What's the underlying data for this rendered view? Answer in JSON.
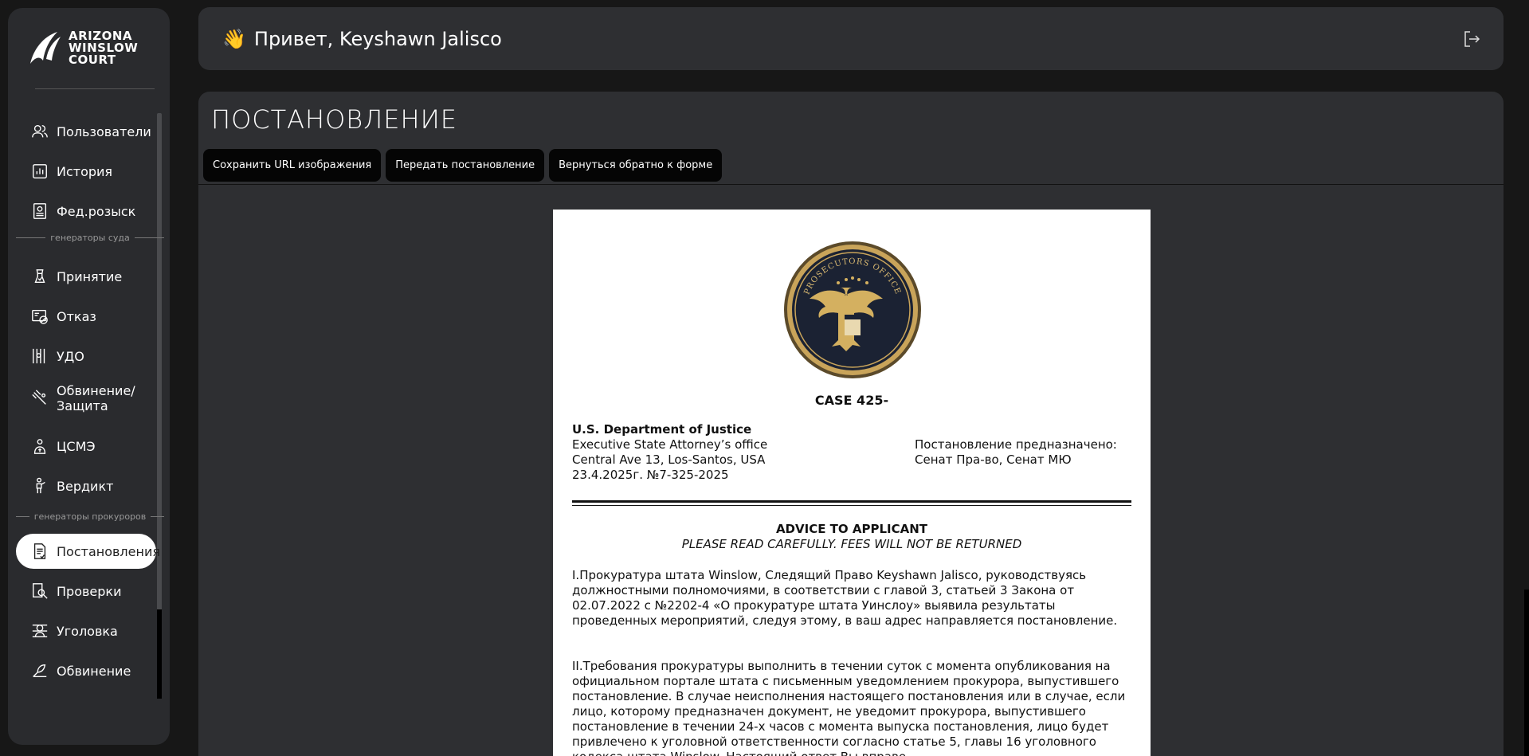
{
  "sidebar": {
    "logo_lines": [
      "ARIZONA",
      "WINSLOW",
      "COURT"
    ],
    "items": [
      {
        "label": "Пользователи",
        "icon": "users-icon"
      },
      {
        "label": "История",
        "icon": "chart-icon"
      },
      {
        "label": "Фед.розыск",
        "icon": "wanted-poster-icon"
      },
      {
        "label": "Принятие",
        "icon": "accept-icon"
      },
      {
        "label": "Отказ",
        "icon": "refusal-icon"
      },
      {
        "label": "УДО",
        "icon": "prison-bars-icon"
      },
      {
        "label": "Обвинение/ Защита",
        "icon": "gavel-icon"
      },
      {
        "label": "ЦСМЭ",
        "icon": "medical-examiner-icon"
      },
      {
        "label": "Вердикт",
        "icon": "verdict-icon"
      },
      {
        "label": "Постановления",
        "icon": "document-icon"
      },
      {
        "label": "Проверки",
        "icon": "inspection-icon"
      },
      {
        "label": "Уголовка",
        "icon": "criminal-icon"
      },
      {
        "label": "Обвинение",
        "icon": "accusation-icon"
      }
    ],
    "section_court": "генераторы суда",
    "section_prosecutors": "генераторы прокуроров",
    "active_item": "Постановления"
  },
  "header": {
    "emoji": "👋",
    "greeting": "Привет, Keyshawn Jalisco",
    "logout_icon": "logout-icon"
  },
  "main": {
    "title": "ПОСТАНОВЛЕНИЕ",
    "buttons": {
      "save_url": "Сохранить URL изображения",
      "send": "Передать постановление",
      "back": "Вернуться обратно к форме"
    }
  },
  "document": {
    "seal_text": "PROSECUTORS OFFICE",
    "case_number": "CASE 425-",
    "department": "U.S. Department of Justice",
    "office": "Executive State Attorney’s office",
    "address": "Central Ave 13, Los-Santos, USA",
    "date_ref": "23.4.2025г. №7-325-2025",
    "addressee_label": "Постановление предназначено:",
    "addressee_value": "Сенат Пра-во, Сенат МЮ",
    "advice_title": "ADVICE TO APPLICANT",
    "advice_subtitle": "PLEASE READ CAREFULLY. FEES WILL NOT BE RETURNED",
    "paragraph_1": "I.Прокуратура штата Winslow, Следящий Право Keyshawn Jalisco, руководствуясь должностными полномочиями, в соответствии с главой 3, статьей 3 Закона от 02.07.2022 с №2202-4 «О прокуратуре штата Уинслоу» выявила результаты проведенных мероприятий, следуя этому, в ваш адрес направляется постановление.",
    "paragraph_2": "II.Требования прокуратуры выполнить в течении суток с момента опубликования на официальном портале штата с письменным уведомлением прокурора, выпустившего постановление. В случае неисполнения настоящего постановления или в случае, если лицо, которому предназначен документ, не уведомит прокурора, выпустившего постановление в течении 24-х часов с момента выпуска постановления, лицо будет привлечено к уголовной ответственности согласно статье 5, главы 16 уголовного кодекса штата Winslow. Настоящий ответ Вы вправе"
  },
  "colors": {
    "background": "#171717",
    "panel": "#2e2f32",
    "sidebar": "#2a2b2e",
    "button": "#050505",
    "active_item_bg": "#ffffff",
    "seal_gold": "#c9a45a",
    "seal_navy": "#1b2233"
  }
}
